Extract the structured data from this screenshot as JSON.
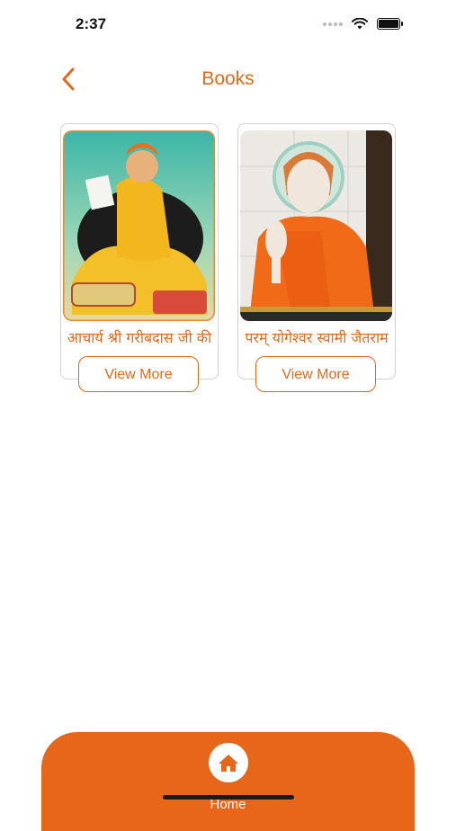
{
  "status_bar": {
    "time": "2:37"
  },
  "header": {
    "title": "Books",
    "back_icon": "chevron-left-icon"
  },
  "books": [
    {
      "title": "आचार्य श्री गरीबदास जी की",
      "button_label": "View More"
    },
    {
      "title": "परम् योगेश्वर स्वामी जैतराम",
      "button_label": "View More"
    }
  ],
  "bottom_nav": {
    "home_label": "Home",
    "home_icon": "home-icon"
  },
  "colors": {
    "accent": "#e06a1c",
    "bar": "#e8661a"
  }
}
